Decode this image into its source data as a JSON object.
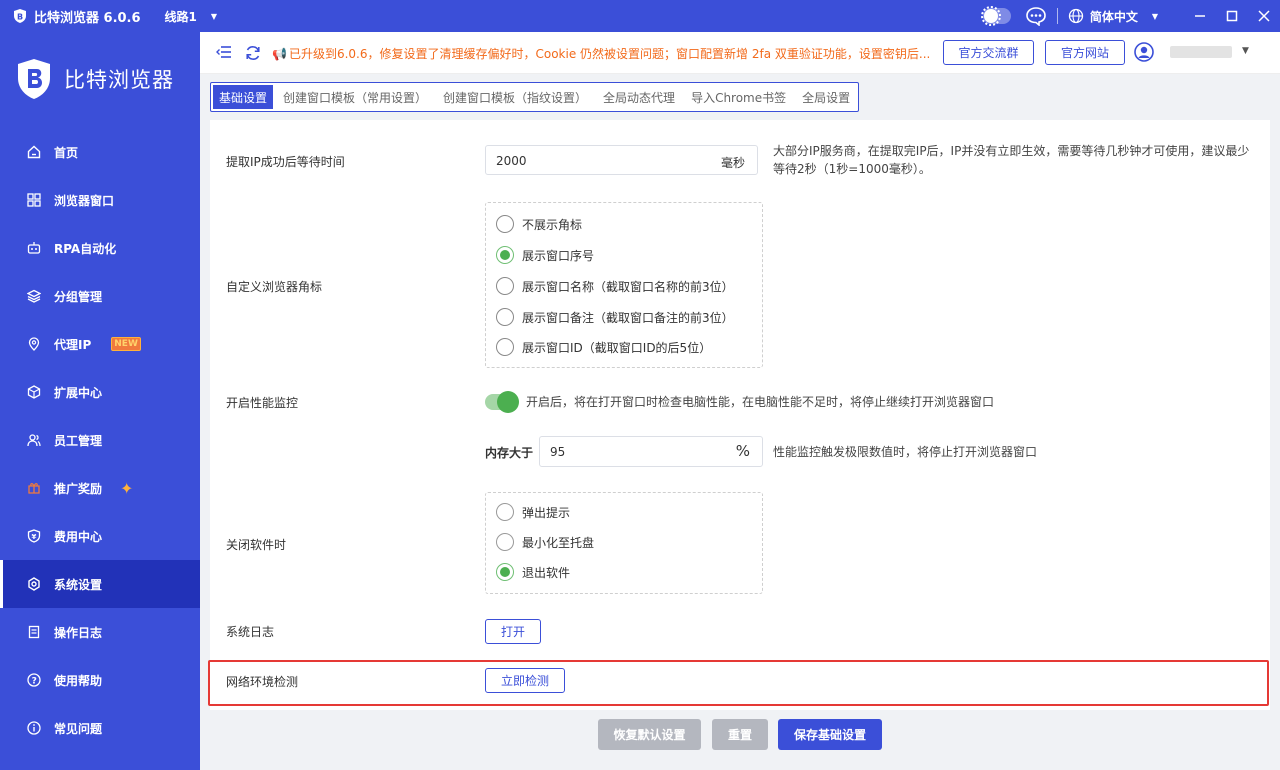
{
  "titlebar": {
    "app_title": "比特浏览器 6.0.6",
    "line_label": "线路1",
    "language": "简体中文"
  },
  "sidebar": {
    "brand": "比特浏览器",
    "items": [
      {
        "label": "首页",
        "icon": "home-icon"
      },
      {
        "label": "浏览器窗口",
        "icon": "grid-icon"
      },
      {
        "label": "RPA自动化",
        "icon": "robot-icon"
      },
      {
        "label": "分组管理",
        "icon": "layers-icon"
      },
      {
        "label": "代理IP",
        "icon": "location-icon",
        "badge": "NEW"
      },
      {
        "label": "扩展中心",
        "icon": "cube-icon"
      },
      {
        "label": "员工管理",
        "icon": "users-icon"
      },
      {
        "label": "推广奖励",
        "icon": "gift-icon"
      },
      {
        "label": "费用中心",
        "icon": "wallet-icon"
      },
      {
        "label": "系统设置",
        "icon": "settings-icon",
        "active": true
      },
      {
        "label": "操作日志",
        "icon": "log-icon"
      },
      {
        "label": "使用帮助",
        "icon": "help-icon"
      },
      {
        "label": "常见问题",
        "icon": "info-icon"
      }
    ]
  },
  "topbar": {
    "notice": "已升级到6.0.6，修复设置了清理缓存偏好时，Cookie 仍然被设置问题；窗口配置新增 2fa 双重验证功能，设置密钥后...",
    "community_button": "官方交流群",
    "website_button": "官方网站"
  },
  "tabs": [
    {
      "label": "基础设置",
      "active": true
    },
    {
      "label": "创建窗口模板（常用设置）"
    },
    {
      "label": "创建窗口模板（指纹设置）"
    },
    {
      "label": "全局动态代理"
    },
    {
      "label": "导入Chrome书签"
    },
    {
      "label": "全局设置"
    }
  ],
  "settings": {
    "ip_wait": {
      "label": "提取IP成功后等待时间",
      "value": "2000",
      "unit": "毫秒",
      "help": "大部分IP服务商，在提取完IP后，IP并没有立即生效，需要等待几秒钟才可使用，建议最少等待2秒（1秒=1000毫秒）。"
    },
    "badge": {
      "label": "自定义浏览器角标",
      "options": [
        {
          "label": "不展示角标",
          "selected": false
        },
        {
          "label": "展示窗口序号",
          "selected": true
        },
        {
          "label": "展示窗口名称（截取窗口名称的前3位）",
          "selected": false
        },
        {
          "label": "展示窗口备注（截取窗口备注的前3位）",
          "selected": false
        },
        {
          "label": "展示窗口ID（截取窗口ID的后5位）",
          "selected": false
        }
      ]
    },
    "perf": {
      "label": "开启性能监控",
      "enabled": true,
      "help": "开启后，将在打开窗口时检查电脑性能，在电脑性能不足时，将停止继续打开浏览器窗口",
      "memory_label": "内存大于",
      "memory_value": "95",
      "memory_unit": "%",
      "memory_help": "性能监控触发极限数值时，将停止打开浏览器窗口"
    },
    "close": {
      "label": "关闭软件时",
      "options": [
        {
          "label": "弹出提示",
          "selected": false
        },
        {
          "label": "最小化至托盘",
          "selected": false
        },
        {
          "label": "退出软件",
          "selected": true
        }
      ]
    },
    "log": {
      "label": "系统日志",
      "button": "打开"
    },
    "network": {
      "label": "网络环境检测",
      "button": "立即检测"
    }
  },
  "footer": {
    "restore": "恢复默认设置",
    "reset": "重置",
    "save": "保存基础设置"
  }
}
